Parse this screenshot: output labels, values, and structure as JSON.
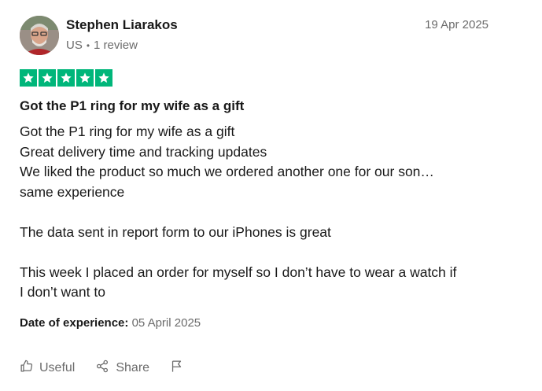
{
  "review": {
    "author": "Stephen Liarakos",
    "country": "US",
    "separator": "•",
    "review_count": "1 review",
    "date": "19 Apr 2025",
    "rating": 5,
    "title": "Got the P1 ring for my wife as a gift",
    "body_lines": [
      "Got the P1 ring for my wife as a gift",
      "Great delivery time and tracking updates",
      "We liked the product so much we ordered another one for our son…",
      "same experience",
      "",
      "The data sent in report form to our iPhones is great",
      "",
      "This week I placed an order for myself so I don’t have to wear a watch if",
      "I don’t want to"
    ],
    "date_of_experience_label": "Date of experience:",
    "date_of_experience": "05 April 2025"
  },
  "actions": {
    "useful_label": "Useful",
    "share_label": "Share",
    "useful_icon": "thumbs-up-icon",
    "share_icon": "share-icon",
    "flag_icon": "flag-icon"
  },
  "colors": {
    "star_green": "#00b67a",
    "muted_text": "#6b6b6b",
    "text": "#191919"
  }
}
